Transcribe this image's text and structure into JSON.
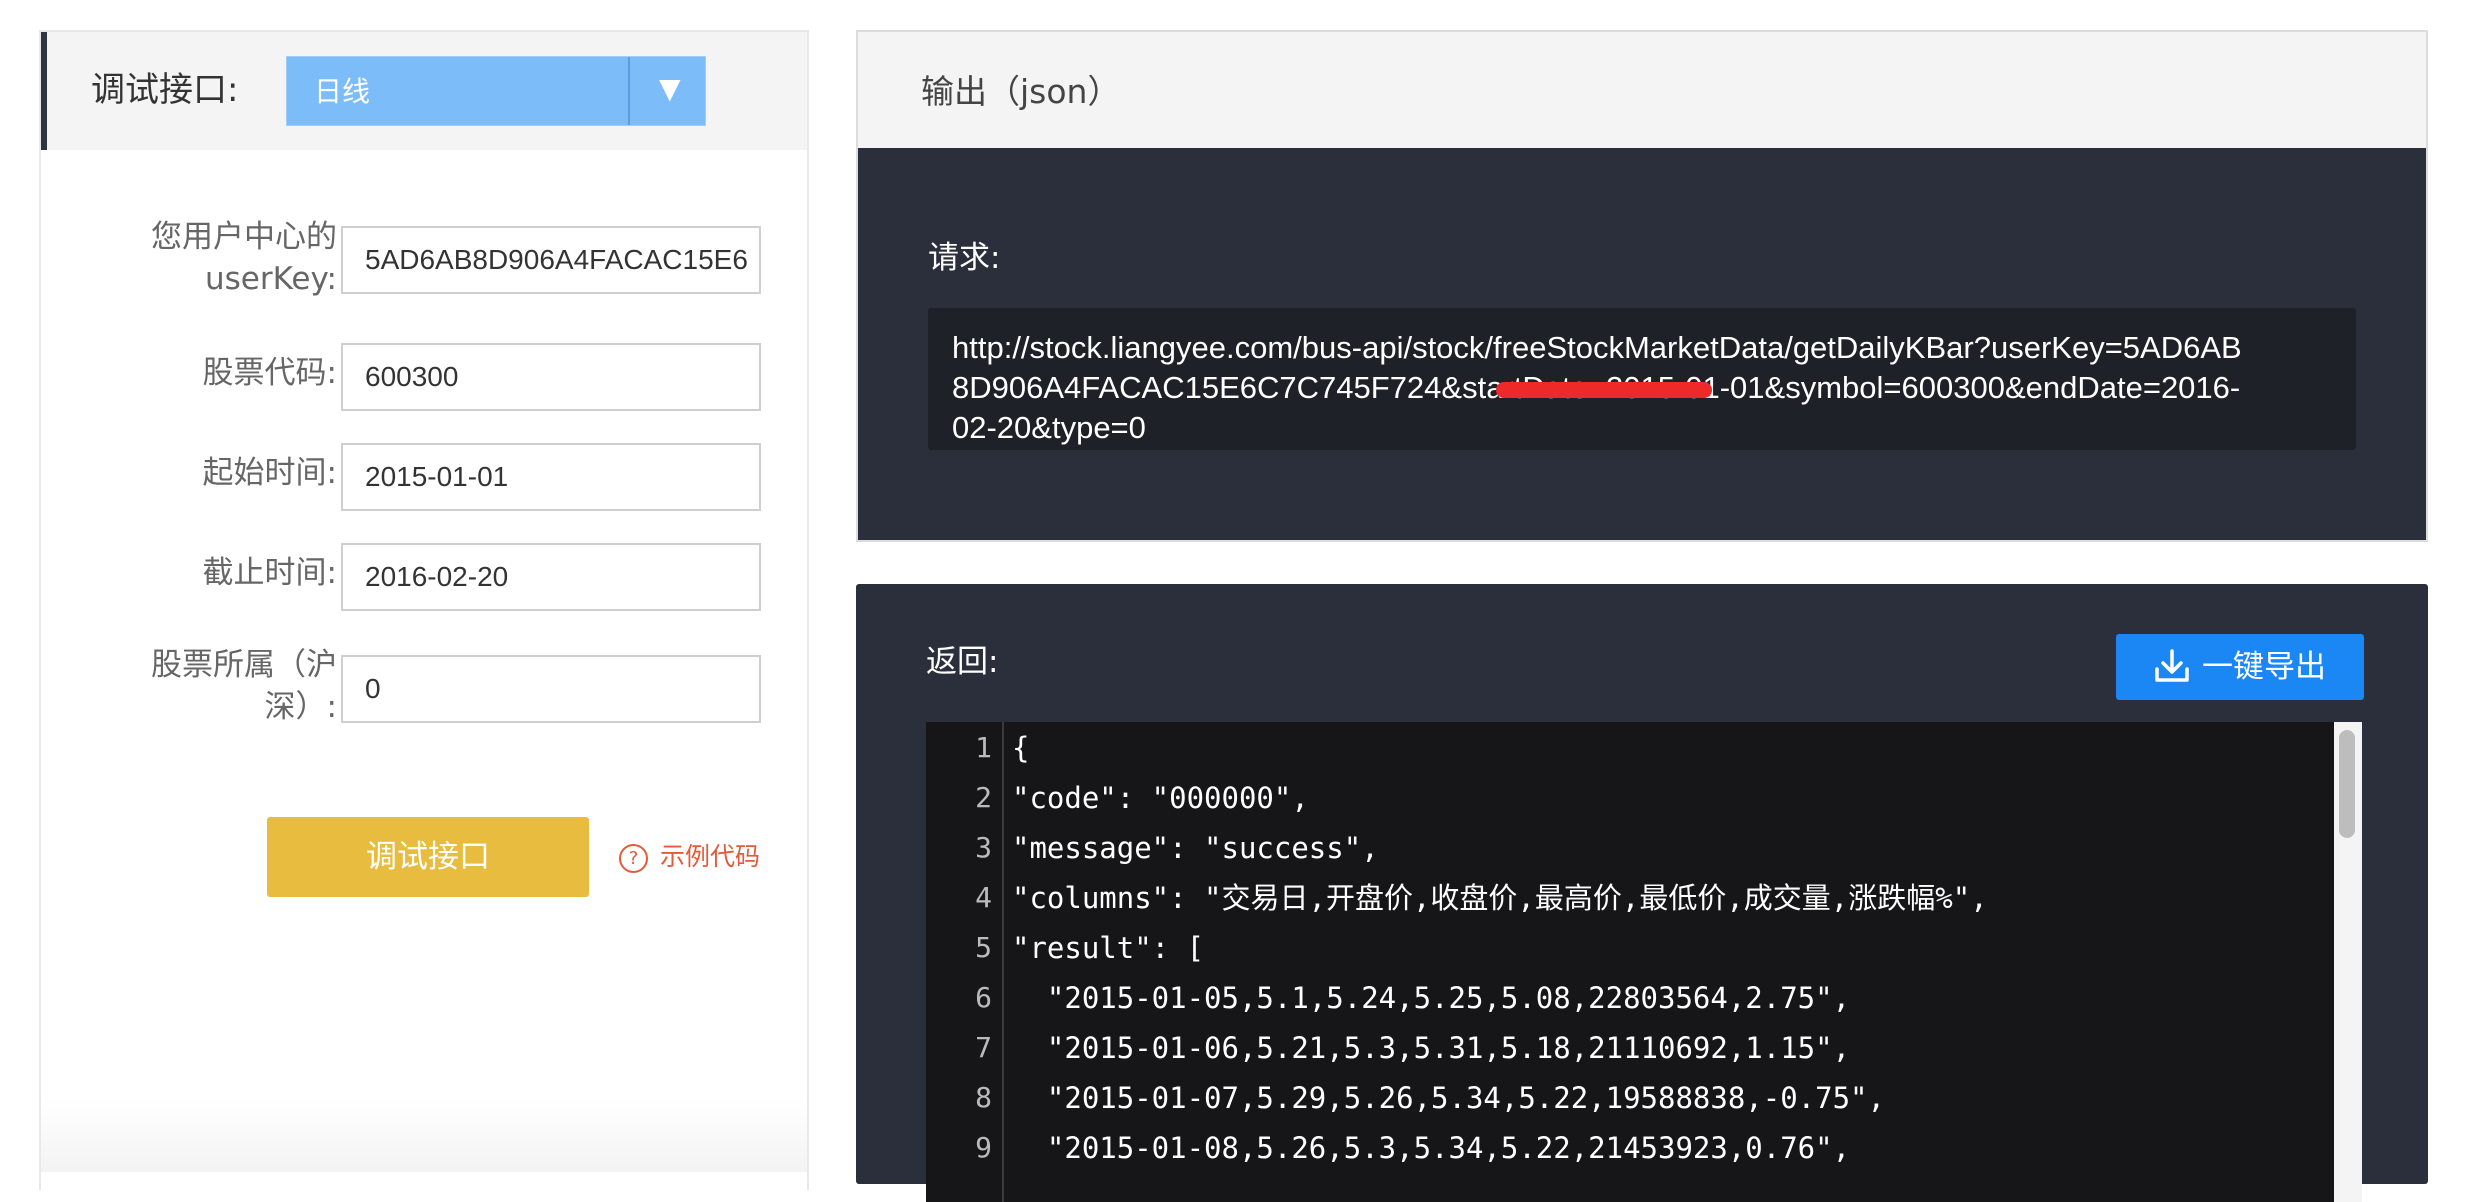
{
  "left_panel": {
    "header_title": "调试接口:",
    "api_select": {
      "value": "日线",
      "arrow": "▼"
    },
    "fields": {
      "userkey": {
        "label": "您用户中心的userKey:",
        "value": "5AD6AB8D906A4FACAC15E6"
      },
      "stock_code": {
        "label": "股票代码:",
        "value": "600300"
      },
      "start_date": {
        "label": "起始时间:",
        "value": "2015-01-01"
      },
      "end_date": {
        "label": "截止时间:",
        "value": "2016-02-20"
      },
      "market": {
        "label": "股票所属（沪深）:",
        "value": "0"
      }
    },
    "debug_button": "调试接口",
    "sample_code_link": "示例代码",
    "question_icon": "?"
  },
  "output_panel": {
    "title": "输出（json）",
    "request_label": "请求:",
    "request_url": "http://stock.liangyee.com/bus-api/stock/freeStockMarketData/getDailyKBar?userKey=5AD6AB8D906A4FACAC15E6C7C745F724&startDate=2015-01-01&symbol=600300&endDate=2016-02-20&type=0"
  },
  "return_panel": {
    "label": "返回:",
    "export_button": "一键导出",
    "code_lines": [
      {
        "num": "1",
        "text": "{"
      },
      {
        "num": "2",
        "text": "\"code\": \"000000\","
      },
      {
        "num": "3",
        "text": "\"message\": \"success\","
      },
      {
        "num": "4",
        "text": "\"columns\": \"交易日,开盘价,收盘价,最高价,最低价,成交量,涨跌幅%\","
      },
      {
        "num": "5",
        "text": "\"result\": ["
      },
      {
        "num": "6",
        "text": "  \"2015-01-05,5.1,5.24,5.25,5.08,22803564,2.75\","
      },
      {
        "num": "7",
        "text": "  \"2015-01-06,5.21,5.3,5.31,5.18,21110692,1.15\","
      },
      {
        "num": "8",
        "text": "  \"2015-01-07,5.29,5.26,5.34,5.22,19588838,-0.75\","
      },
      {
        "num": "9",
        "text": "  \"2015-01-08,5.26,5.3,5.34,5.22,21453923,0.76\","
      }
    ]
  },
  "colors": {
    "dark_panel": "#2b2f3b",
    "select_blue": "#7cbcf8",
    "export_blue": "#1b87f5",
    "debug_yellow": "#e8bd3f",
    "link_red": "#e35b3a"
  }
}
